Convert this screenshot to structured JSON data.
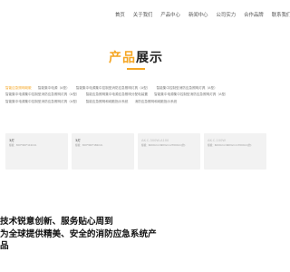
{
  "nav": {
    "items": [
      "首页",
      "关于我们",
      "产品中心",
      "新闻中心",
      "公司实力",
      "合作品牌",
      "联系我们"
    ]
  },
  "section": {
    "title_accent": "产品",
    "title_rest": "展示"
  },
  "categories": [
    {
      "label": "智能应急照明疏散",
      "active": true
    },
    {
      "label": "智能集中电源（A型）",
      "active": false
    },
    {
      "label": "智能集中电源集中控制型消防应急照明灯具（A型）",
      "active": false
    },
    {
      "label": "智能集中控制型消防应急照明灯具（A型）",
      "active": false
    },
    {
      "label": "智能集中电源集中控制型消防应急照明灯具（A型）",
      "active": false
    },
    {
      "label": "智能应急照明集中电源应急照明分配电装置",
      "active": false
    },
    {
      "label": "智能集中电源集中控制型消防应急照明灯具（A型）",
      "active": false
    },
    {
      "label": "智能集中电源集中控制型消防应急照明灯具（A型）",
      "active": false
    },
    {
      "label": "智能应急照明和疏散指示系统",
      "active": false
    },
    {
      "label": "消防应急照明和疏散指示系统",
      "active": false
    }
  ],
  "products": [
    {
      "name": "3灯",
      "spec": "规格：300*300*110mm",
      "light": false
    },
    {
      "name": "3灯",
      "spec": "规格：300*300*180mm",
      "light": false
    },
    {
      "name": "AK-C-300W-A100",
      "spec": "规格：600mm×490mm×2700mm(约)",
      "light": true
    },
    {
      "name": "AK-C-100W",
      "spec": "规格：600mm×490mm×1700mm(约)",
      "light": true
    }
  ],
  "slogan": {
    "lines": [
      "技术锐意创新、服务贴心周到",
      "为全球提供精美、安全的消防应急系统产",
      "品"
    ]
  },
  "colors": {
    "accent": "#f5a623",
    "card_bg": "#f2f2f2"
  }
}
